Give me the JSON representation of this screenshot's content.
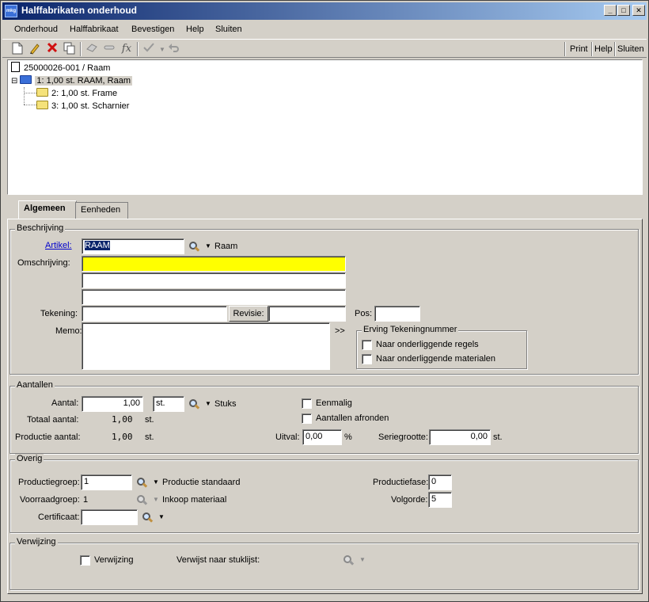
{
  "window": {
    "title": "Halffabrikaten onderhoud",
    "icon_label": "mkg"
  },
  "menu": [
    "Onderhoud",
    "Halffabrikaat",
    "Bevestigen",
    "Help",
    "Sluiten"
  ],
  "toolbar": {
    "icons": [
      "new-document-icon",
      "edit-pencil-icon",
      "delete-x-icon",
      "copy-icon",
      "eraser-icon",
      "clear-icon",
      "function-icon",
      "confirm-check-icon",
      "undo-icon"
    ],
    "function_glyph": "fx",
    "print": "Print",
    "help": "Help",
    "close": "Sluiten"
  },
  "tree": {
    "root": "25000026-001 / Raam",
    "nodes": [
      {
        "label": "1: 1,00 st. RAAM, Raam",
        "selected": true
      },
      {
        "label": "2: 1,00 st.  Frame"
      },
      {
        "label": "3: 1,00 st.  Scharnier"
      }
    ],
    "expander": "⊟"
  },
  "tabs": [
    "Algemeen",
    "Eenheden"
  ],
  "beschrijving": {
    "title": "Beschrijving",
    "artikel_label": "Artikel:",
    "artikel_value": "RAAM",
    "artikel_desc": "Raam",
    "omschrijving_label": "Omschrijving:",
    "tekening_label": "Tekening:",
    "revisie_label": "Revisie:",
    "pos_label": "Pos:",
    "memo_label": "Memo:",
    "memo_more": ">>",
    "erving_title": "Erving Tekeningnummer",
    "erving_regels": "Naar onderliggende regels",
    "erving_materialen": "Naar onderliggende materialen"
  },
  "aantallen": {
    "title": "Aantallen",
    "aantal_label": "Aantal:",
    "aantal_value": "1,00",
    "unit_value": "st.",
    "unit_desc": "Stuks",
    "totaal_label": "Totaal aantal:",
    "totaal_value": "1,00",
    "totaal_unit": "st.",
    "productie_label": "Productie aantal:",
    "productie_value": "1,00",
    "productie_unit": "st.",
    "eenmalig": "Eenmalig",
    "afronden": "Aantallen afronden",
    "uitval_label": "Uitval:",
    "uitval_value": "0,00",
    "uitval_unit": "%",
    "serie_label": "Seriegrootte:",
    "serie_value": "0,00",
    "serie_unit": "st."
  },
  "overig": {
    "title": "Overig",
    "productiegroep_label": "Productiegroep:",
    "productiegroep_value": "1",
    "productiegroep_desc": "Productie standaard",
    "voorraadgroep_label": "Voorraadgroep:",
    "voorraadgroep_value": "1",
    "voorraadgroep_desc": "Inkoop materiaal",
    "certificaat_label": "Certificaat:",
    "productiefase_label": "Productiefase:",
    "productiefase_value": "0",
    "volgorde_label": "Volgorde:",
    "volgorde_value": "5"
  },
  "verwijzing": {
    "title": "Verwijzing",
    "checkbox": "Verwijzing",
    "stuklijst_label": "Verwijst naar stuklijst:"
  },
  "glyphs": {
    "dropdown": "▼",
    "minimize": "_",
    "maximize": "□",
    "close": "✕"
  },
  "colors": {
    "title_start": "#0a246a",
    "title_end": "#a6caf0",
    "highlight_field": "#ffff00",
    "link": "#0000cc",
    "face": "#d4d0c8"
  }
}
